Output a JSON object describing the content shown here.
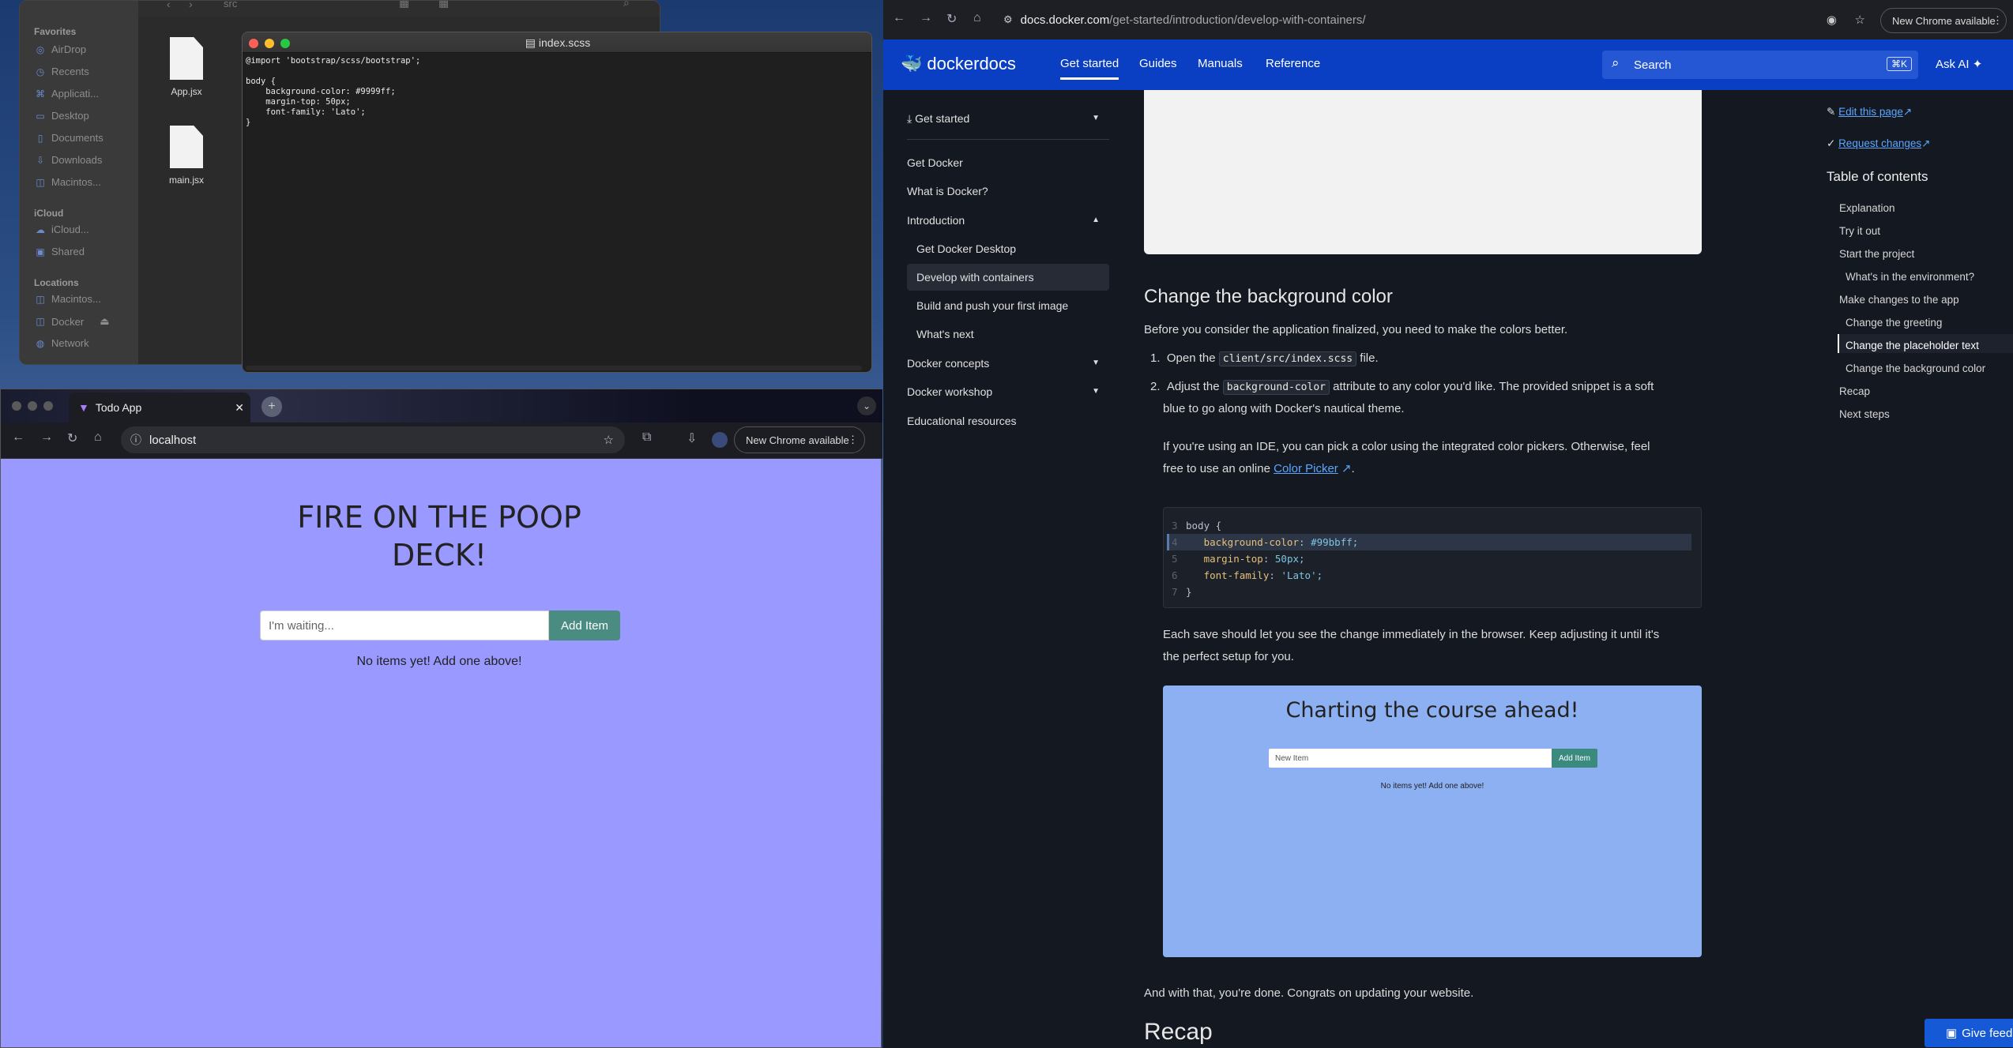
{
  "finder": {
    "path": "src",
    "favorites_label": "Favorites",
    "favorites": [
      {
        "label": "AirDrop",
        "icon": "airdrop-icon"
      },
      {
        "label": "Recents",
        "icon": "clock-icon"
      },
      {
        "label": "Applicati...",
        "icon": "applications-icon"
      },
      {
        "label": "Desktop",
        "icon": "desktop-icon"
      },
      {
        "label": "Documents",
        "icon": "document-icon"
      },
      {
        "label": "Downloads",
        "icon": "download-icon"
      },
      {
        "label": "Macintos...",
        "icon": "disk-icon"
      }
    ],
    "icloud_label": "iCloud",
    "icloud": [
      {
        "label": "iCloud...",
        "icon": "cloud-icon"
      },
      {
        "label": "Shared",
        "icon": "shared-folder-icon"
      }
    ],
    "locations_label": "Locations",
    "locations": [
      {
        "label": "Macintos...",
        "icon": "disk-icon"
      },
      {
        "label": "Docker",
        "icon": "disk-icon"
      },
      {
        "label": "Network",
        "icon": "network-icon"
      }
    ],
    "files": [
      {
        "name": "App.jsx"
      },
      {
        "name": "main.jsx"
      }
    ]
  },
  "editor": {
    "title": "index.scss",
    "code": "@import 'bootstrap/scss/bootstrap';\n\nbody {\n    background-color: #9999ff;\n    margin-top: 50px;\n    font-family: 'Lato';\n}"
  },
  "chrome_left": {
    "tab_title": "Todo App",
    "url": "localhost",
    "new_chrome": "New Chrome available"
  },
  "todo": {
    "title": "FIRE ON THE POOP DECK!",
    "input_placeholder": "I'm waiting...",
    "add_button": "Add Item",
    "empty_text": "No items yet! Add one above!"
  },
  "chrome_right": {
    "url_host": "docs.docker.com",
    "url_path": "/get-started/introduction/develop-with-containers/",
    "new_chrome": "New Chrome available"
  },
  "docs": {
    "logo": "dockerdocs",
    "nav": [
      "Get started",
      "Guides",
      "Manuals",
      "Reference"
    ],
    "search_placeholder": "Search",
    "search_shortcut": "⌘K",
    "ask_ai": "Ask AI",
    "sidebar": {
      "get_started": "Get started",
      "get_docker": "Get Docker",
      "what_is_docker": "What is Docker?",
      "introduction": "Introduction",
      "intro_items": [
        "Get Docker Desktop",
        "Develop with containers",
        "Build and push your first image",
        "What's next"
      ],
      "docker_concepts": "Docker concepts",
      "docker_workshop": "Docker workshop",
      "educational": "Educational resources"
    },
    "main": {
      "heading": "Change the background color",
      "intro": "Before you consider the application finalized, you need to make the colors better.",
      "step1_pre": "Open the",
      "step1_code": "client/src/index.scss",
      "step1_post": "file.",
      "step2_pre": "Adjust the",
      "step2_code": "background-color",
      "step2_post": "attribute to any color you'd like. The provided snippet is a soft",
      "step2_line2": "blue to go along with Docker's nautical theme.",
      "ide_line1": "If you're using an IDE, you can pick a color using the integrated color pickers. Otherwise, feel",
      "ide_line2_pre": "free to use an online",
      "ide_link": "Color Picker",
      "code_lines": [
        {
          "n": "3",
          "text": "body {"
        },
        {
          "n": "4",
          "prop": "background-color",
          "val": "#99bbff;"
        },
        {
          "n": "5",
          "prop": "margin-top",
          "val": "50px;"
        },
        {
          "n": "6",
          "prop": "font-family",
          "val": "'Lato';"
        },
        {
          "n": "7",
          "text": "}"
        }
      ],
      "save_line1": "Each save should let you see the change immediately in the browser. Keep adjusting it until it's",
      "save_line2": "the perfect setup for you.",
      "shot_title": "Charting the course ahead!",
      "shot_placeholder": "New Item",
      "shot_add": "Add Item",
      "shot_empty": "No items yet! Add one above!",
      "done": "And with that, you're done. Congrats on updating your website.",
      "recap": "Recap"
    },
    "toc": {
      "edit": "Edit this page",
      "request": "Request changes",
      "title": "Table of contents",
      "items": [
        "Explanation",
        "Try it out",
        "Start the project",
        "What's in the environment?",
        "Make changes to the app",
        "Change the greeting",
        "Change the placeholder text",
        "Change the background color",
        "Recap",
        "Next steps"
      ]
    },
    "feedback": "Give feedback"
  },
  "colors": {
    "todo_bg": "#9999ff",
    "docker_blue": "#0a3fc4",
    "add_button": "#4a8c82",
    "shot_bg": "#8cb0f2"
  }
}
